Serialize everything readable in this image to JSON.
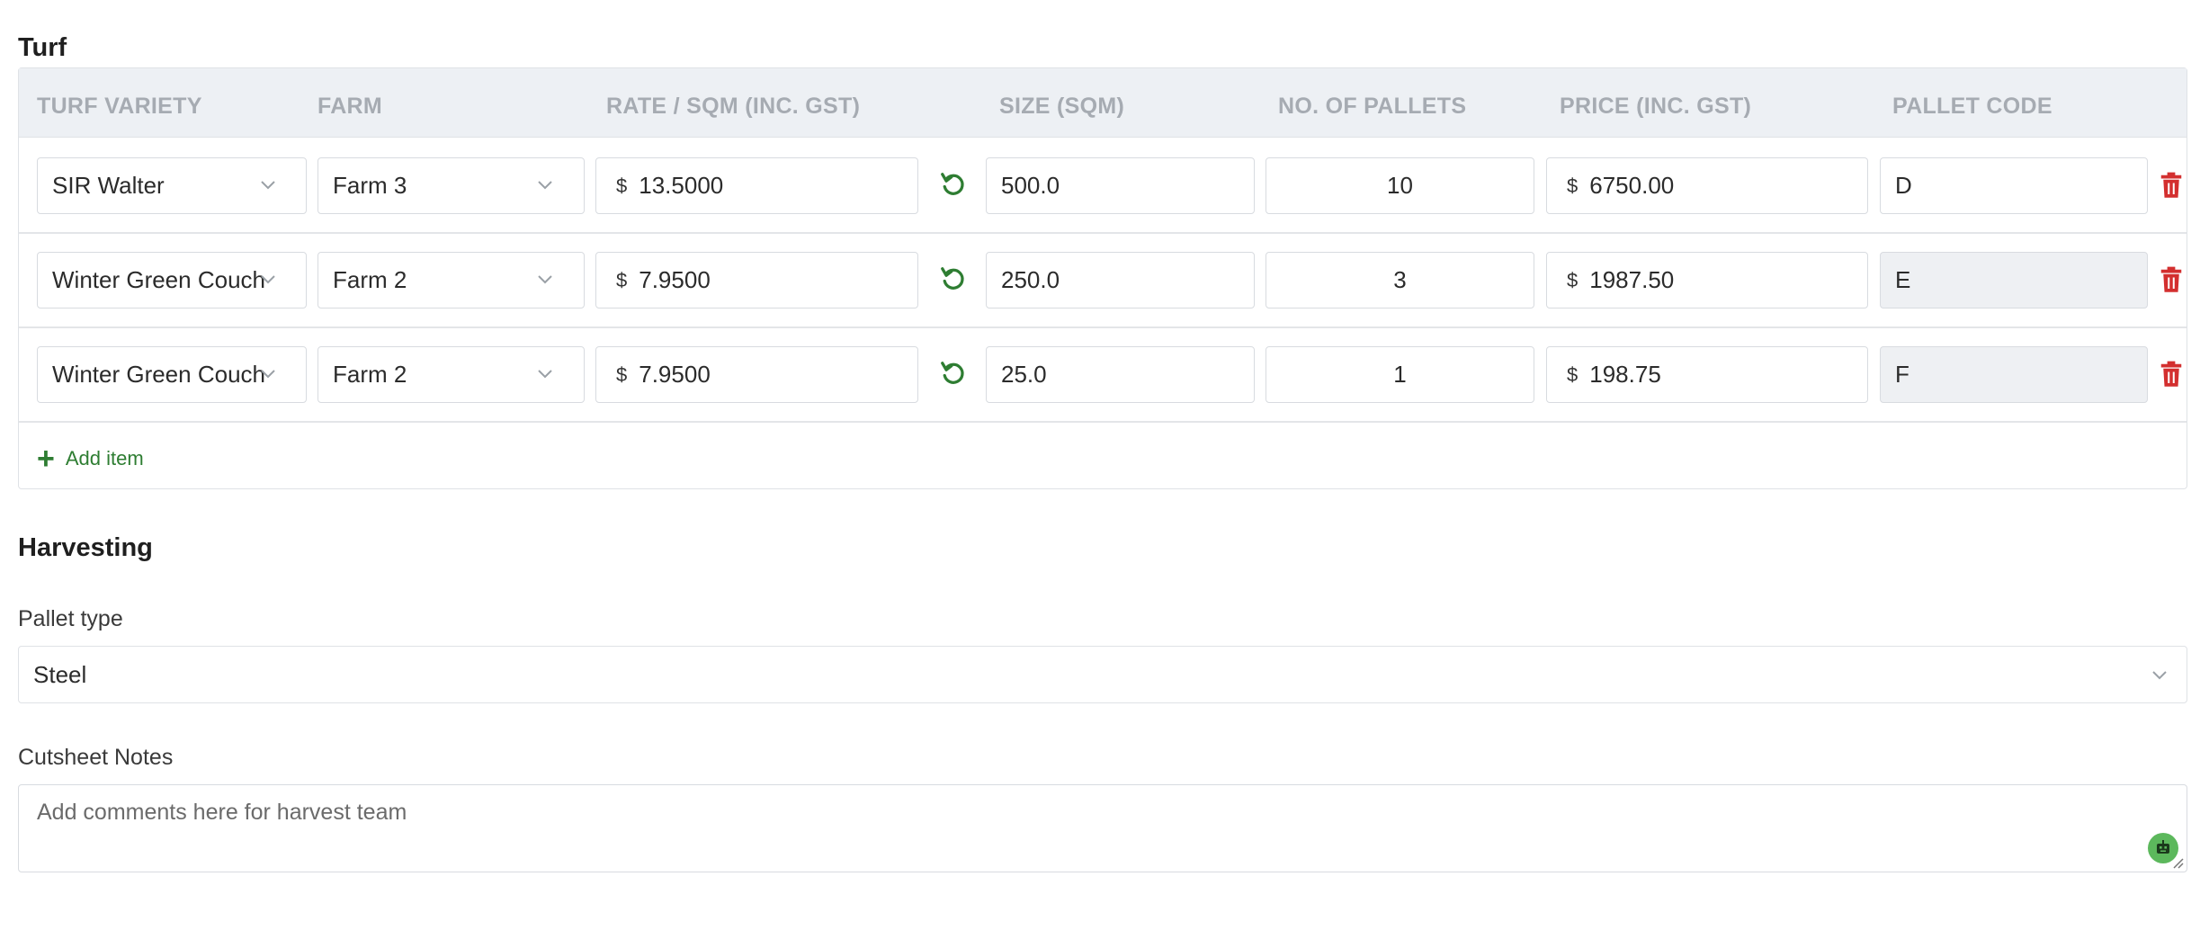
{
  "turf": {
    "title": "Turf",
    "headers": {
      "variety": "TURF VARIETY",
      "farm": "FARM",
      "rate": "RATE / SQM (INC. GST)",
      "size": "SIZE (SQM)",
      "pallets": "NO. OF PALLETS",
      "price": "PRICE (INC. GST)",
      "code": "PALLET CODE"
    },
    "currency_symbol": "$",
    "rows": [
      {
        "variety": "SIR Walter",
        "farm": "Farm 3",
        "rate": "13.5000",
        "size": "500.0",
        "pallets": "10",
        "price": "6750.00",
        "code": "D",
        "code_readonly": false
      },
      {
        "variety": "Winter Green Couch",
        "farm": "Farm 2",
        "rate": "7.9500",
        "size": "250.0",
        "pallets": "3",
        "price": "1987.50",
        "code": "E",
        "code_readonly": true
      },
      {
        "variety": "Winter Green Couch",
        "farm": "Farm 2",
        "rate": "7.9500",
        "size": "25.0",
        "pallets": "1",
        "price": "198.75",
        "code": "F",
        "code_readonly": true
      }
    ],
    "add_item_label": "Add item",
    "icons": {
      "reset": "reset-icon",
      "delete": "trash-icon",
      "dropdown": "chevron-down-icon",
      "add": "plus-icon"
    }
  },
  "harvesting": {
    "title": "Harvesting",
    "pallet_type_label": "Pallet type",
    "pallet_type_value": "Steel",
    "notes_label": "Cutsheet Notes",
    "notes_placeholder": "Add comments here for harvest team"
  },
  "colors": {
    "accent_green": "#2e7d32",
    "delete_red": "#d32f2f",
    "header_bg": "#edf0f4",
    "readonly_bg": "#eef0f3"
  }
}
